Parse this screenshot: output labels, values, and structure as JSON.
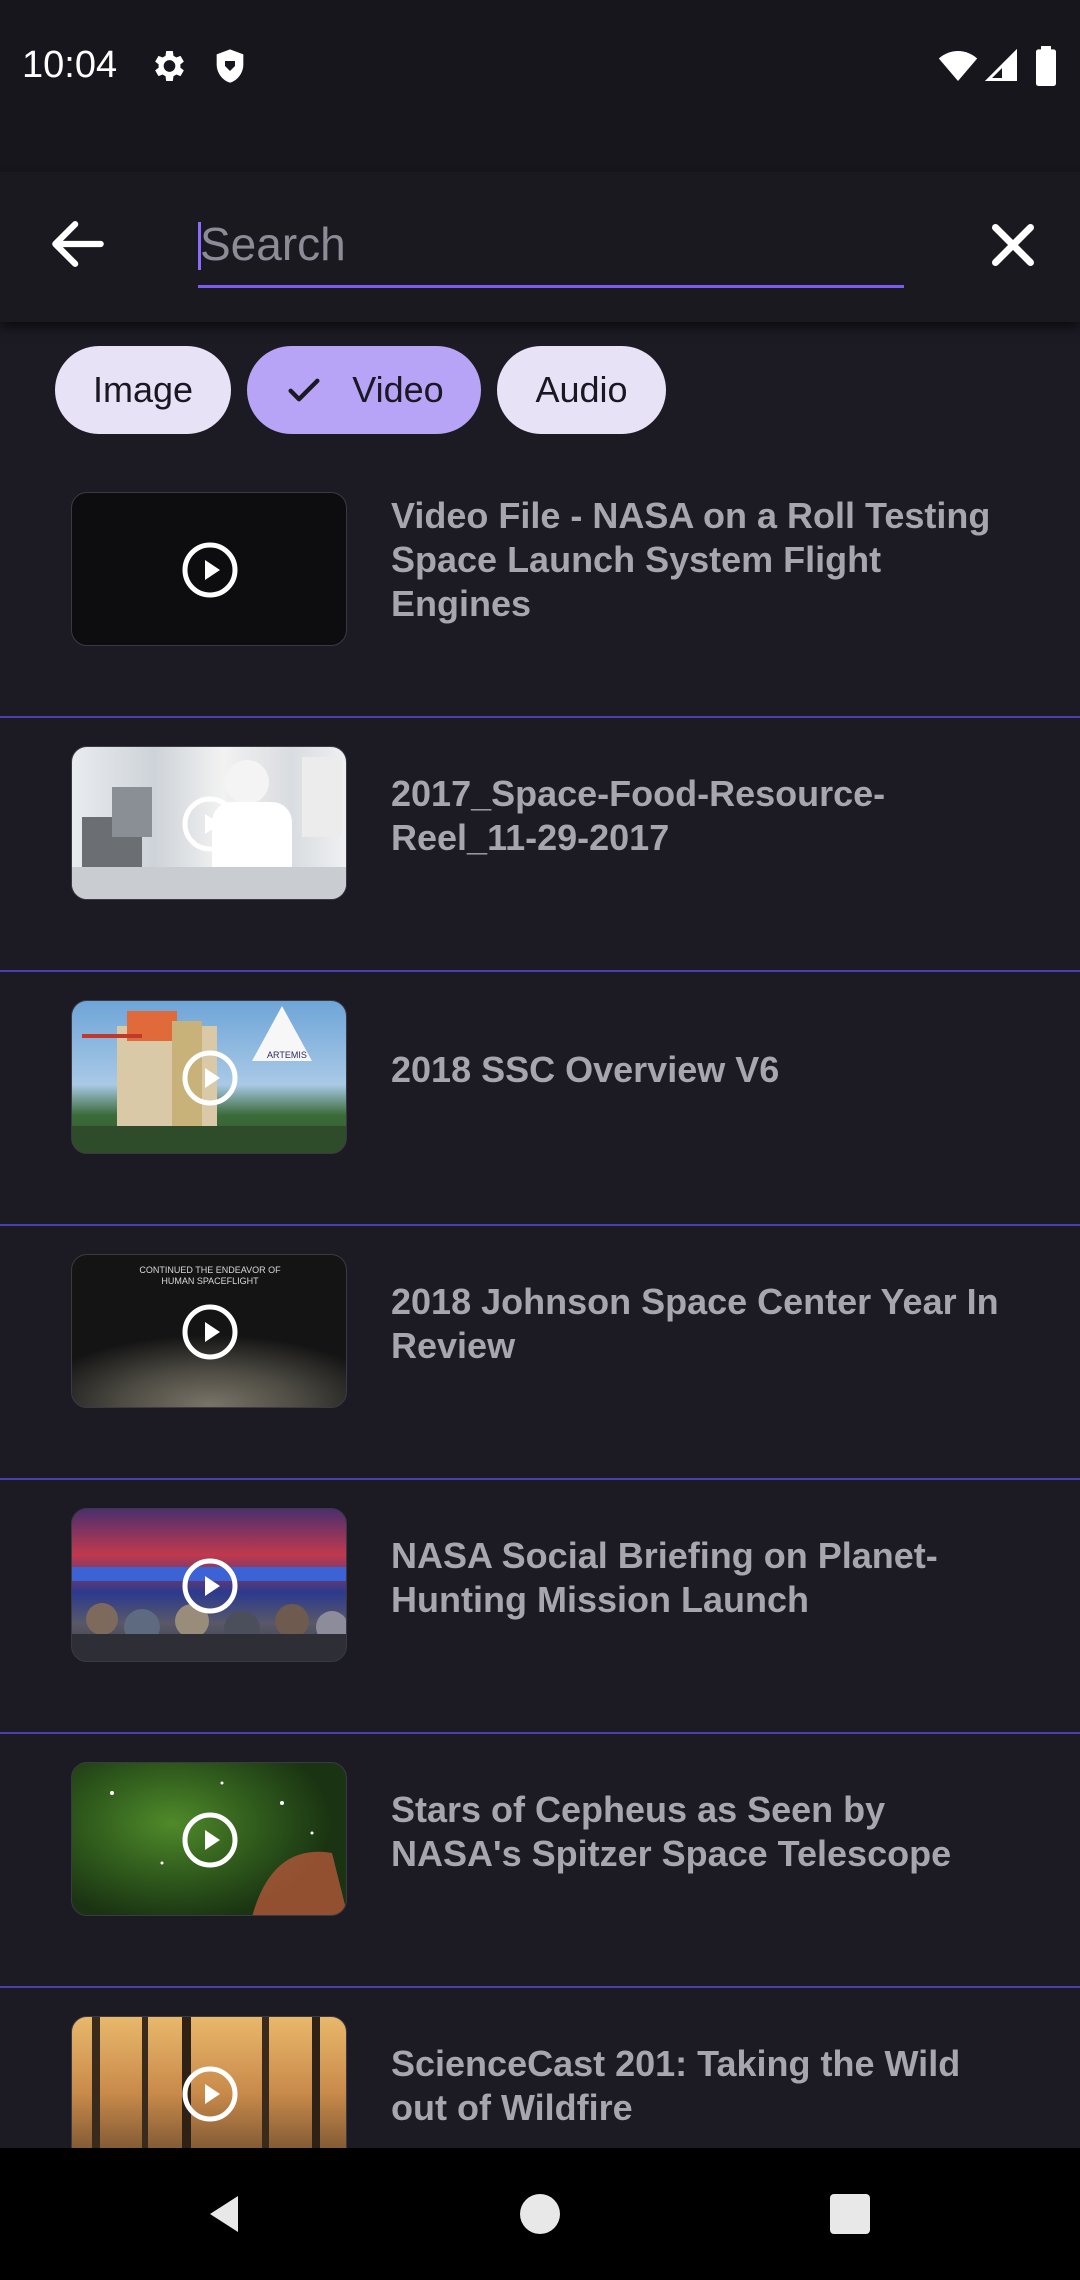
{
  "status_bar": {
    "time": "10:04",
    "icons": [
      "gear-icon",
      "shield-icon",
      "wifi-icon",
      "signal-icon",
      "battery-icon"
    ]
  },
  "search": {
    "placeholder": "Search",
    "value": "",
    "accent_color": "#7b5cf0"
  },
  "filters": [
    {
      "label": "Image",
      "selected": false
    },
    {
      "label": "Video",
      "selected": true
    },
    {
      "label": "Audio",
      "selected": false
    }
  ],
  "results": [
    {
      "title": "Video File - NASA on a Roll Testing Space Launch System Flight Engines",
      "thumbnail": "black-frame"
    },
    {
      "title": "2017_Space-Food-Resource-Reel_11-29-2017",
      "thumbnail": "lab-technician"
    },
    {
      "title": "2018 SSC Overview V6",
      "thumbnail": "test-stand-artemis"
    },
    {
      "title": "2018 Johnson Space Center Year In Review",
      "thumbnail": "earth-from-orbit",
      "thumbnail_caption": "CONTINUED THE ENDEAVOR OF\nHUMAN SPACEFLIGHT"
    },
    {
      "title": "NASA Social Briefing on Planet-Hunting Mission Launch",
      "thumbnail": "press-briefing"
    },
    {
      "title": "Stars of Cepheus as Seen by NASA's Spitzer Space Telescope",
      "thumbnail": "green-nebula"
    },
    {
      "title": "ScienceCast 201: Taking the Wild out of Wildfire",
      "thumbnail": "forest-fire"
    }
  ],
  "colors": {
    "background": "#1c1b24",
    "divider": "#4a3fb0",
    "chip": "#e8e2f7",
    "chip_selected": "#b7a4f7"
  }
}
